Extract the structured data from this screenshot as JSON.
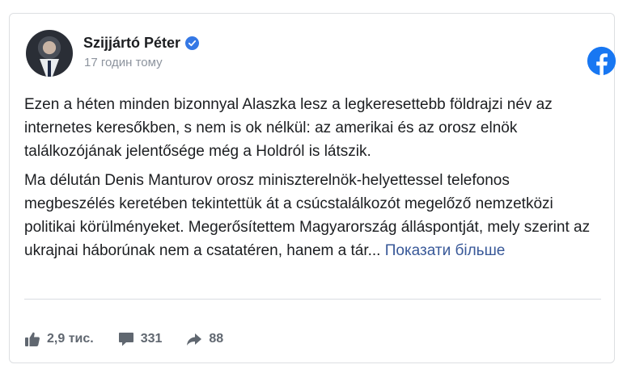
{
  "post": {
    "author": "Szijjártó Péter",
    "timestamp": "17 годин тому",
    "paragraphs": [
      "Ezen a héten minden bizonnyal Alaszka lesz a legkeresettebb földrajzi név az internetes keresőkben, s nem is ok nélkül: az amerikai és az orosz elnök találkozójának jelentősége még a Holdról is látszik.",
      "Ma délután Denis Manturov orosz miniszterelnök-helyettessel telefonos megbeszélés keretében tekintettük át a csúcstalálkozót megelőző nemzetközi politikai körülményeket. Megerősítettem Magyarország álláspontját, mely szerint az ukrajnai háborúnak nem a csatatéren, hanem a tár..."
    ],
    "see_more": "Показати більше"
  },
  "stats": {
    "likes": "2,9 тис.",
    "comments": "331",
    "shares": "88"
  },
  "icons": {
    "verified": "verified-badge-icon",
    "platform": "facebook-logo-icon",
    "like": "thumbs-up-icon",
    "comment": "comment-icon",
    "share": "share-arrow-icon"
  },
  "colors": {
    "brand": "#1877f2",
    "link": "#385898",
    "muted": "#606770"
  }
}
